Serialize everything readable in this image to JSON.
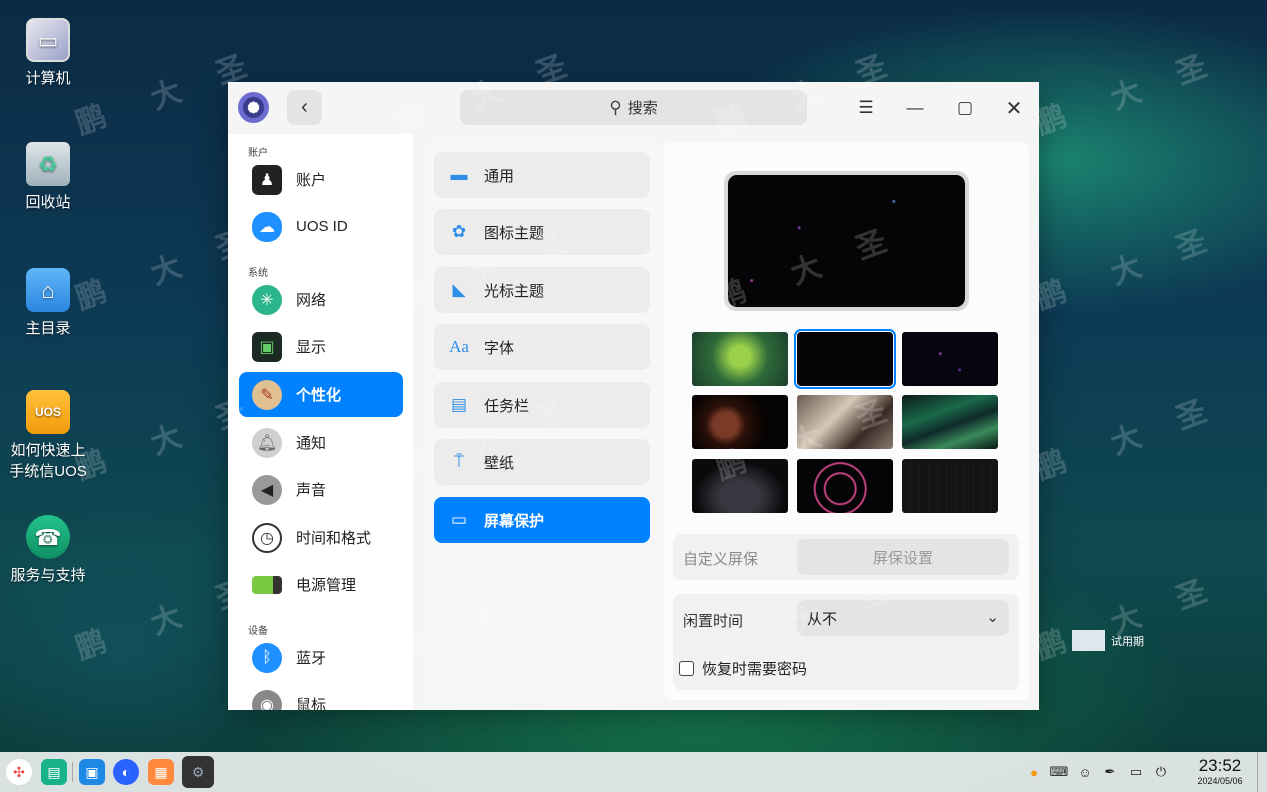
{
  "desktop": {
    "icons": [
      {
        "label": "计算机",
        "icon": "computer-icon"
      },
      {
        "label": "回收站",
        "icon": "trash-icon"
      },
      {
        "label": "主目录",
        "icon": "home-folder-icon"
      },
      {
        "label_line1": "如何快速上",
        "label_line2": "手统信UOS",
        "icon": "uos-help-icon",
        "icon_text": "UOS"
      },
      {
        "label": "服务与支持",
        "icon": "support-icon"
      }
    ],
    "trial_text": "试用期"
  },
  "window": {
    "search_placeholder": "搜索",
    "sidebar": {
      "sections": [
        "账户",
        "系统",
        "设备"
      ],
      "items": [
        {
          "label": "账户",
          "icon": "account-icon"
        },
        {
          "label": "UOS ID",
          "icon": "cloud-icon"
        },
        {
          "label": "网络",
          "icon": "network-icon"
        },
        {
          "label": "显示",
          "icon": "display-icon"
        },
        {
          "label": "个性化",
          "icon": "personalization-icon",
          "active": true
        },
        {
          "label": "通知",
          "icon": "bell-icon"
        },
        {
          "label": "声音",
          "icon": "speaker-icon"
        },
        {
          "label": "时间和格式",
          "icon": "clock-icon"
        },
        {
          "label": "电源管理",
          "icon": "battery-icon"
        },
        {
          "label": "蓝牙",
          "icon": "bluetooth-icon"
        },
        {
          "label": "鼠标",
          "icon": "mouse-icon"
        }
      ]
    },
    "personalization_menu": [
      {
        "label": "通用",
        "icon": "general-icon"
      },
      {
        "label": "图标主题",
        "icon": "icon-theme-icon"
      },
      {
        "label": "光标主题",
        "icon": "cursor-theme-icon"
      },
      {
        "label": "字体",
        "icon": "font-icon",
        "icon_text": "Aa"
      },
      {
        "label": "任务栏",
        "icon": "taskbar-icon"
      },
      {
        "label": "壁纸",
        "icon": "wallpaper-icon"
      },
      {
        "label": "屏幕保护",
        "icon": "screensaver-icon",
        "active": true
      }
    ],
    "screensaver": {
      "custom_label": "自定义屏保",
      "settings_button": "屏保设置",
      "idle_label": "闲置时间",
      "idle_value": "从不",
      "require_password_label": "恢复时需要密码",
      "require_password_checked": false,
      "thumbnails": 9,
      "selected_thumbnail": 2
    }
  },
  "taskbar": {
    "time": "23:52",
    "date": "2024/05/06",
    "apps": [
      "launcher-icon",
      "multitask-icon",
      "file-manager-icon",
      "browser-icon",
      "app-store-icon",
      "control-center-icon"
    ],
    "tray": [
      "update-icon",
      "keyboard-icon",
      "user-icon",
      "pen-icon",
      "storage-icon",
      "power-icon"
    ]
  },
  "watermark": {
    "chars": [
      "鹏",
      "大",
      "圣"
    ]
  }
}
